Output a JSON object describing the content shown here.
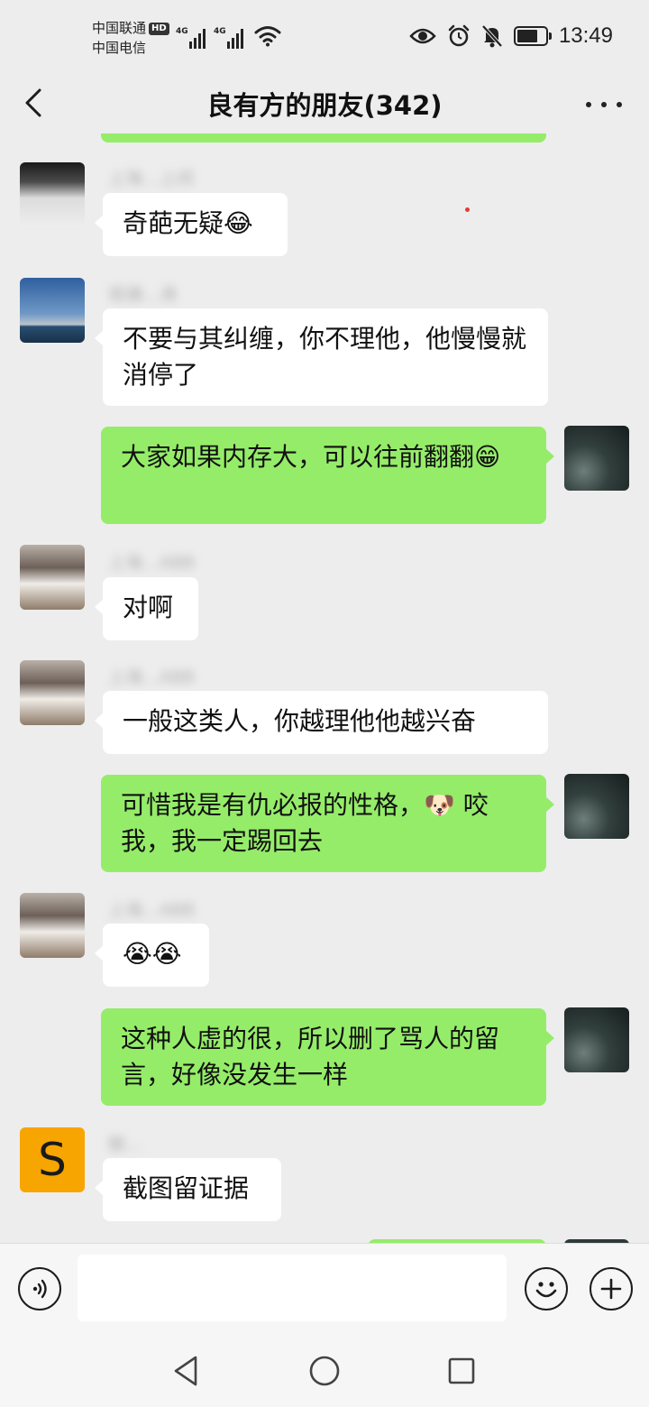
{
  "status_bar": {
    "carrier_1": "中国联通",
    "carrier_1_badge": "HD",
    "carrier_2": "中国电信",
    "network_1": "4G",
    "network_2": "4G",
    "time": "13:49",
    "icons": [
      "eye-icon",
      "alarm-icon",
      "mute-bell-icon",
      "battery-icon",
      "wifi-icon"
    ]
  },
  "header": {
    "title": "良有方的朋友(342)"
  },
  "messages": [
    {
      "direction": "in",
      "sender": "上海…上间",
      "text": "奇葩无疑😂"
    },
    {
      "direction": "in",
      "sender": "观潮…涛",
      "text": "不要与其纠缠，你不理他，他慢慢就消停了"
    },
    {
      "direction": "out",
      "text": "大家如果内存大，可以往前翻翻😁"
    },
    {
      "direction": "in",
      "sender": "上海…ABB",
      "text": "对啊"
    },
    {
      "direction": "in",
      "sender": "上海…ABB",
      "text": "一般这类人，你越理他他越兴奋"
    },
    {
      "direction": "out",
      "text": "可惜我是有仇必报的性格，🐶 咬我，我一定踢回去"
    },
    {
      "direction": "in",
      "sender": "上海…ABB",
      "text": "😭😭"
    },
    {
      "direction": "out",
      "text": "这种人虚的很，所以删了骂人的留言，好像没发生一样"
    },
    {
      "direction": "in",
      "sender": "赖…",
      "text": "截图留证据",
      "avatar_letter": "S"
    }
  ],
  "input_bar": {
    "value": "",
    "icons": [
      "voice-icon",
      "emoji-icon",
      "plus-icon"
    ]
  },
  "nav_bar": {
    "icons": [
      "nav-back-icon",
      "nav-home-icon",
      "nav-recents-icon"
    ]
  },
  "colors": {
    "background": "#ededed",
    "outgoing_bubble": "#95ec69",
    "incoming_bubble": "#ffffff",
    "avatar_s_bg": "#f7a500"
  }
}
